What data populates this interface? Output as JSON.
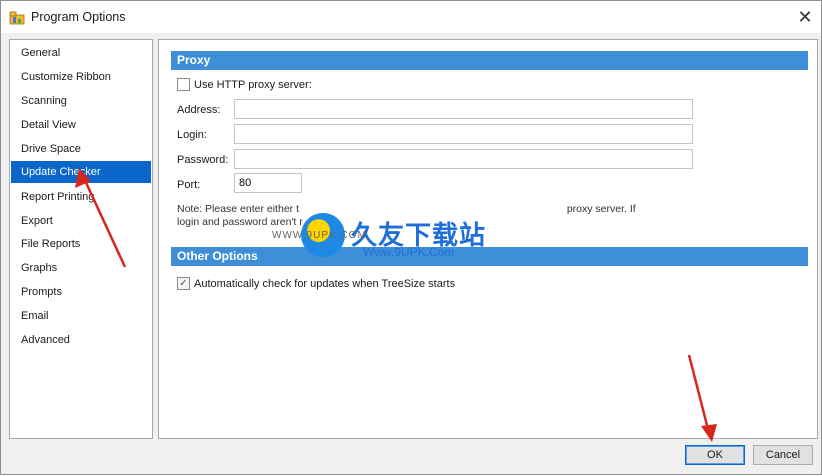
{
  "window": {
    "title": "Program Options"
  },
  "sidebar": {
    "items": [
      {
        "label": "General",
        "selected": false
      },
      {
        "label": "Customize Ribbon",
        "selected": false
      },
      {
        "label": "Scanning",
        "selected": false
      },
      {
        "label": "Detail View",
        "selected": false
      },
      {
        "label": "Drive Space",
        "selected": false
      },
      {
        "label": "Update Checker",
        "selected": true
      },
      {
        "label": "Report Printing",
        "selected": false
      },
      {
        "label": "Export",
        "selected": false
      },
      {
        "label": "File Reports",
        "selected": false
      },
      {
        "label": "Graphs",
        "selected": false
      },
      {
        "label": "Prompts",
        "selected": false
      },
      {
        "label": "Email",
        "selected": false
      },
      {
        "label": "Advanced",
        "selected": false
      }
    ]
  },
  "proxy": {
    "header": "Proxy",
    "use_proxy_label": "Use HTTP proxy server:",
    "use_proxy_checked": false,
    "address_label": "Address:",
    "address_value": "",
    "login_label": "Login:",
    "login_value": "",
    "password_label": "Password:",
    "password_value": "",
    "port_label": "Port:",
    "port_value": "80",
    "note_line1": "Note: Please enter either t",
    "note_line1_end": "proxy server. If",
    "note_line2": "login and password aren't r"
  },
  "other": {
    "header": "Other Options",
    "auto_check_label": "Automatically check for updates when TreeSize starts",
    "auto_check_checked": true
  },
  "buttons": {
    "ok": "OK",
    "cancel": "Cancel"
  },
  "watermark": {
    "big": "久友下载站",
    "small": "Www.9UPK.Com",
    "left": "WWW.9UPK.COM"
  },
  "colors": {
    "accent": "#0a66c8",
    "section_header": "#3e8fd8",
    "arrow": "#d9261c"
  }
}
